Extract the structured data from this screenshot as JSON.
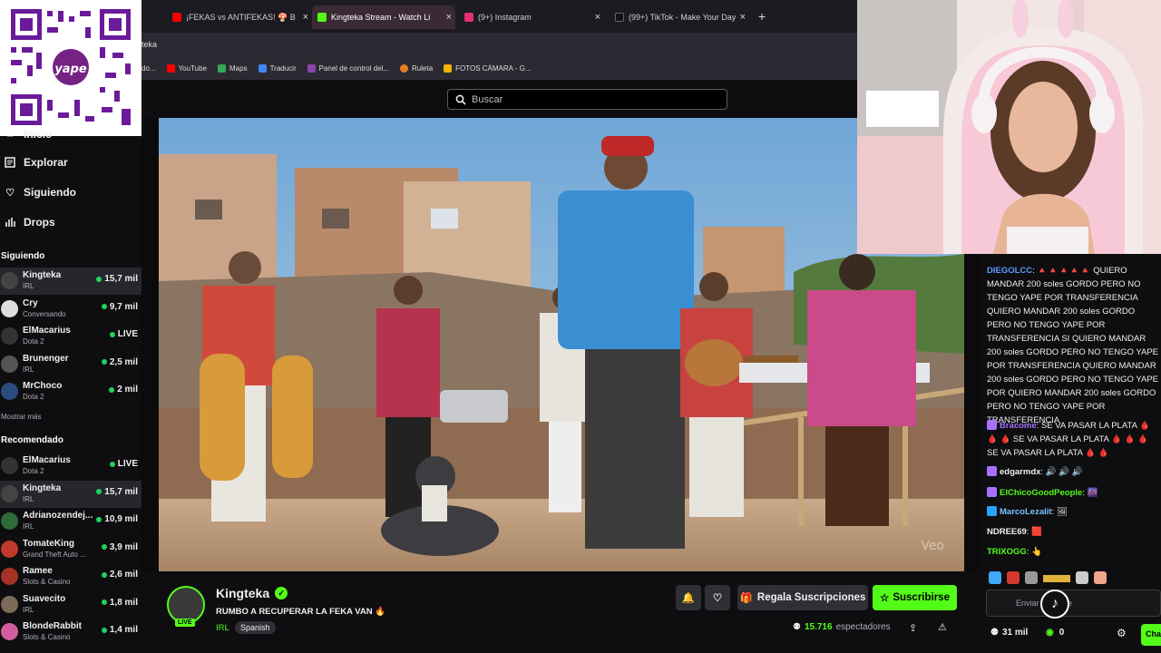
{
  "tabs": [
    {
      "label": "¡FEKAS vs ANTIFEKAS! 🍄 B",
      "color": "#ff0000",
      "active": false
    },
    {
      "label": "Kingteka Stream - Watch Li",
      "color": "#53fc18",
      "active": true
    },
    {
      "label": "(9+) Instagram",
      "color": "#e1306c",
      "active": false
    },
    {
      "label": "(99+) TikTok - Make Your Day",
      "color": "#111111",
      "active": false
    }
  ],
  "address_text": "teka",
  "bookmarks": [
    {
      "label": "do...",
      "color": "#888888"
    },
    {
      "label": "YouTube",
      "color": "#ff0000"
    },
    {
      "label": "Maps",
      "color": "#34a853"
    },
    {
      "label": "Traducir",
      "color": "#4285f4"
    },
    {
      "label": "Panel de control del...",
      "color": "#8e44ad"
    },
    {
      "label": "Ruleta",
      "color": "#e67e22"
    },
    {
      "label": "FOTOS CÁMARA - G...",
      "color": "#f4b400"
    }
  ],
  "qr": {
    "brand": "yape"
  },
  "search": {
    "placeholder": "Buscar"
  },
  "nav": [
    {
      "label": "Inicio",
      "icon": "home-icon"
    },
    {
      "label": "Explorar",
      "icon": "compass-icon"
    },
    {
      "label": "Siguiendo",
      "icon": "heart-icon"
    },
    {
      "label": "Drops",
      "icon": "drops-icon"
    }
  ],
  "following_title": "Siguiendo",
  "following": [
    {
      "name": "Kingteka",
      "category": "IRL",
      "viewers": "15,7 mil",
      "color": "#444",
      "highlight": true
    },
    {
      "name": "Cry",
      "category": "Conversando",
      "viewers": "9,7 mil",
      "color": "#ddd",
      "highlight": false
    },
    {
      "name": "ElMacarius",
      "category": "Dota 2",
      "viewers": "LIVE",
      "color": "#333",
      "highlight": false
    },
    {
      "name": "Brunenger",
      "category": "IRL",
      "viewers": "2,5 mil",
      "color": "#555",
      "highlight": false
    },
    {
      "name": "MrChoco",
      "category": "Dota 2",
      "viewers": "2 mil",
      "color": "#2b4c7e",
      "highlight": false
    }
  ],
  "show_more": "Mostrar más",
  "recommended_title": "Recomendado",
  "recommended": [
    {
      "name": "ElMacarius",
      "category": "Dota 2",
      "viewers": "LIVE",
      "color": "#333",
      "highlight": false
    },
    {
      "name": "Kingteka",
      "category": "IRL",
      "viewers": "15,7 mil",
      "color": "#444",
      "highlight": true
    },
    {
      "name": "Adrianozendej...",
      "category": "IRL",
      "viewers": "10,9 mil",
      "color": "#2e6b3a",
      "highlight": false
    },
    {
      "name": "TomateKing",
      "category": "Grand Theft Auto ...",
      "viewers": "3,9 mil",
      "color": "#c0392b",
      "highlight": false
    },
    {
      "name": "Ramee",
      "category": "Slots & Casino",
      "viewers": "2,6 mil",
      "color": "#a93226",
      "highlight": false
    },
    {
      "name": "Suavecito",
      "category": "IRL",
      "viewers": "1,8 mil",
      "color": "#7d6b5a",
      "highlight": false
    },
    {
      "name": "BlondeRabbit",
      "category": "Slots & Casino",
      "viewers": "1,4 mil",
      "color": "#d35d9e",
      "highlight": false
    }
  ],
  "video_watermark": "Veo",
  "stream": {
    "channel": "Kingteka",
    "title": "RUMBO A RECUPERAR LA FEKA VAN 🔥",
    "category": "IRL",
    "language": "Spanish",
    "live_badge": "LIVE",
    "viewers": "15.716",
    "viewers_label": "espectadores",
    "gift_label": "Regala Suscripciones",
    "subscribe_label": "Suscribirse"
  },
  "chat": [
    {
      "user": "DIEGOLCC",
      "color": "#5b9bff",
      "text": "🔺🔺🔺🔺🔺 QUIERO MANDAR 200 soles GORDO PERO NO TENGO YAPE POR TRANSFERENCIA QUIERO MANDAR 200 soles GORDO PERO NO TENGO YAPE POR TRANSFERENCIA SI QUIERO MANDAR 200 soles GORDO PERO NO TENGO YAPE POR TRANSFERENCIA QUIERO MANDAR 200 soles GORDO PERO NO TENGO YAPE POR QUIERO MANDAR 200 soles GORDO PERO NO TENGO YAPE POR TRANSFERENCIA"
    },
    {
      "user": "Bracome",
      "color": "#a970ff",
      "text": "SE VA PASAR LA PLATA 🩸 🩸 🩸 SE VA PASAR LA PLATA 🩸 🩸 🩸 SE VA PASAR LA PLATA 🩸 🩸"
    },
    {
      "user": "edgarmdx",
      "color": "#efeff1",
      "text": "🔊 🔊 🔊"
    },
    {
      "user": "ElChicoGoodPeople",
      "color": "#53fc18",
      "text": "🌆"
    },
    {
      "user": "MarcoLezalit",
      "color": "#7ac6ff",
      "text": "🖼"
    },
    {
      "user": "NDREE69",
      "color": "#efeff1",
      "text": "🟥"
    },
    {
      "user": "TRIXOGG",
      "color": "#53fc18",
      "text": "👆"
    }
  ],
  "chat_input_placeholder": "Enviar mensaje",
  "chat_footer": {
    "count": "31 mil",
    "points": "0",
    "send_label": "Chat"
  }
}
